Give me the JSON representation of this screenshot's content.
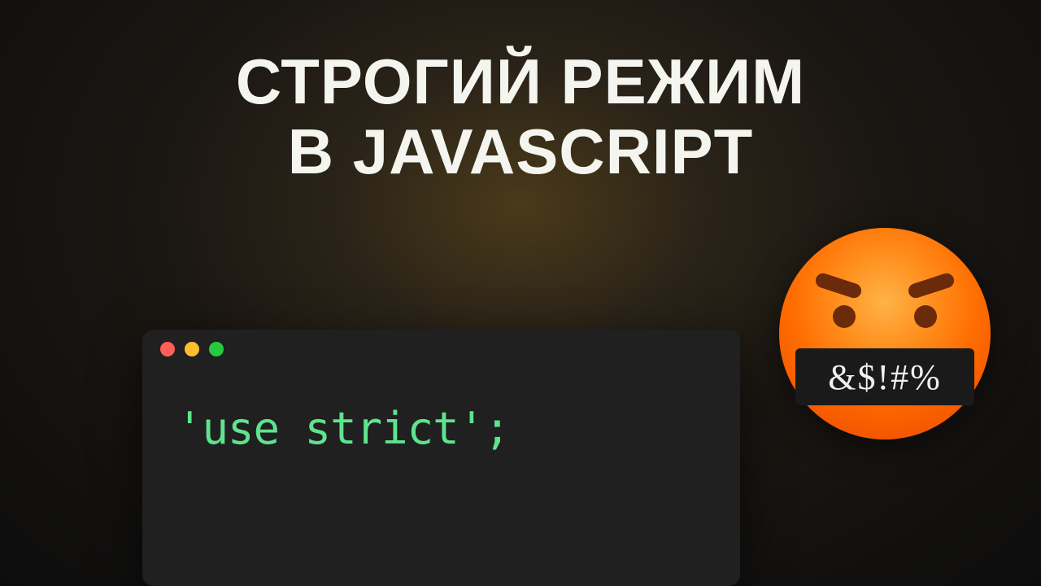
{
  "title": {
    "line1": "СТРОГИЙ РЕЖИМ",
    "line2": "В JAVASCRIPT"
  },
  "code": {
    "content": "'use strict';"
  },
  "emoji": {
    "censor_text": "&$!#%"
  }
}
